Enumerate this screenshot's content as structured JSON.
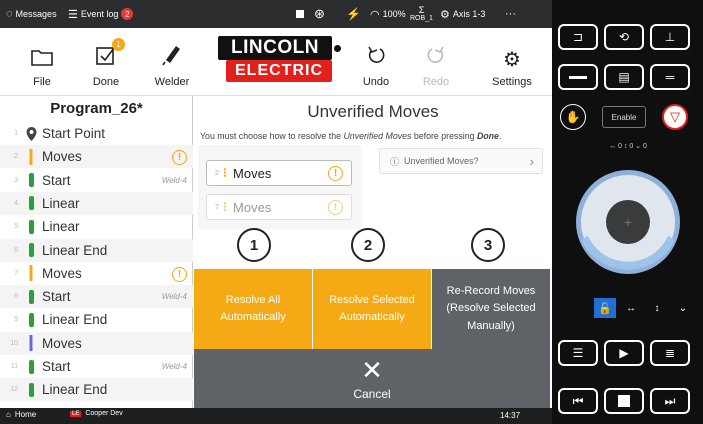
{
  "statusbar": {
    "messages": "Messages",
    "event_log": "Event log",
    "event_count": "2",
    "battery": "100%",
    "robot": "ROB_1",
    "axis": "Axis 1-3",
    "more": "···"
  },
  "toolbar": {
    "file": "File",
    "done": "Done",
    "done_badge": "1",
    "welder": "Welder",
    "undo": "Undo",
    "redo": "Redo",
    "settings": "Settings",
    "logo_top": "LINCOLN",
    "logo_bottom": "ELECTRIC"
  },
  "program": {
    "title": "Program_26*",
    "rows": [
      {
        "num": "1",
        "label": "Start Point",
        "tag": "",
        "kind": "point",
        "warn": false
      },
      {
        "num": "2",
        "label": "Moves",
        "tag": "",
        "kind": "moves-orange",
        "warn": true
      },
      {
        "num": "3",
        "label": "Start",
        "tag": "Weld-4",
        "kind": "green",
        "warn": false
      },
      {
        "num": "4",
        "label": "Linear",
        "tag": "",
        "kind": "green",
        "warn": false
      },
      {
        "num": "5",
        "label": "Linear",
        "tag": "",
        "kind": "green",
        "warn": false
      },
      {
        "num": "6",
        "label": "Linear End",
        "tag": "",
        "kind": "green",
        "warn": false
      },
      {
        "num": "7",
        "label": "Moves",
        "tag": "",
        "kind": "moves-orange",
        "warn": true
      },
      {
        "num": "8",
        "label": "Start",
        "tag": "Weld-4",
        "kind": "green",
        "warn": false
      },
      {
        "num": "9",
        "label": "Linear End",
        "tag": "",
        "kind": "green",
        "warn": false
      },
      {
        "num": "10",
        "label": "Moves",
        "tag": "",
        "kind": "moves-purple",
        "warn": false
      },
      {
        "num": "11",
        "label": "Start",
        "tag": "Weld-4",
        "kind": "green",
        "warn": false
      },
      {
        "num": "12",
        "label": "Linear End",
        "tag": "",
        "kind": "green",
        "warn": false
      }
    ]
  },
  "main": {
    "title": "Unverified Moves",
    "instruction_prefix": "You must choose how to resolve the ",
    "instruction_em": "Unverified Moves",
    "instruction_suffix": " before pressing ",
    "instruction_strong": "Done",
    "instruction_end": ".",
    "moves_cards": [
      {
        "num": "2",
        "label": "Moves"
      },
      {
        "num": "7",
        "label": "Moves"
      }
    ],
    "help_label": "Unverified Moves?",
    "options": [
      {
        "number": "1",
        "label_line1": "Resolve All",
        "label_line2": "Automatically",
        "label_line3": ""
      },
      {
        "number": "2",
        "label_line1": "Resolve Selected",
        "label_line2": "Automatically",
        "label_line3": ""
      },
      {
        "number": "3",
        "label_line1": "Re-Record Moves",
        "label_line2": "(Resolve Selected",
        "label_line3": "Manually)"
      }
    ],
    "cancel": "Cancel"
  },
  "bottombar": {
    "home": "Home",
    "user": "Cooper Dev",
    "time": "14:37"
  },
  "pendant": {
    "enable": "Enable",
    "axis_readout": "↔ 0  ↕ 0  ⌄ 0"
  },
  "colors": {
    "orange": "#f5a915",
    "gray_button": "#5f6266",
    "green_segment": "#2e9e3b",
    "purple_segment": "#6b63d9",
    "lincoln_red": "#e2211c"
  }
}
